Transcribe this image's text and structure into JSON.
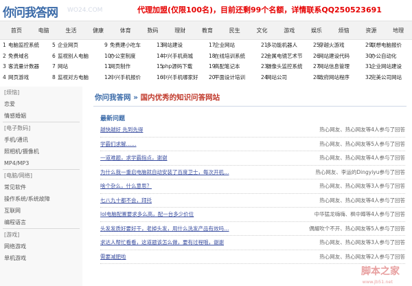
{
  "header": {
    "logo": "你问我答网",
    "logo_sub": "WO24.COM",
    "promo": "代理加盟(仅限100名)，目前还剩99个名额，详情联系QQ250523691"
  },
  "nav": [
    "首页",
    "电脑",
    "生活",
    "健康",
    "体育",
    "数码",
    "理财",
    "教育",
    "民生",
    "文化",
    "游戏",
    "娱乐",
    "烦恼",
    "资源",
    "地理"
  ],
  "links": [
    [
      [
        "1",
        "电脑监控系统"
      ],
      [
        "5",
        "企业网页"
      ],
      [
        "9",
        "免费建小吃车"
      ],
      [
        "13",
        "网站建设"
      ],
      [
        "17",
        "企业网站"
      ],
      [
        "21",
        "多功能机器人"
      ],
      [
        "25",
        "穿越火游戏"
      ],
      [
        "29",
        "联想电脑报价"
      ]
    ],
    [
      [
        "2",
        "免费域名"
      ],
      [
        "6",
        "监视别人电脑"
      ],
      [
        "10",
        "办公室制度"
      ],
      [
        "14",
        "中兴手机商城"
      ],
      [
        "18",
        "在线培训系统"
      ],
      [
        "22",
        "金属电镜艺术节"
      ],
      [
        "26",
        "网站建设代码"
      ],
      [
        "30",
        "办公自动化"
      ]
    ],
    [
      [
        "3",
        "客流量计数器"
      ],
      [
        "7",
        "网站"
      ],
      [
        "11",
        "网页制作"
      ],
      [
        "15",
        "php源码下载"
      ],
      [
        "19",
        "高配笔记本"
      ],
      [
        "23",
        "摄像头监控系统"
      ],
      [
        "27",
        "网站信息管理"
      ],
      [
        "31",
        "企业网站建设"
      ]
    ],
    [
      [
        "4",
        "网页游戏"
      ],
      [
        "8",
        "监视对方电脑"
      ],
      [
        "12",
        "中兴手机报价"
      ],
      [
        "16",
        "中兴手机哪家好"
      ],
      [
        "20",
        "平面设计培训"
      ],
      [
        "24",
        "网站公司"
      ],
      [
        "28",
        "政府网站程序"
      ],
      [
        "32",
        "完美公司网站"
      ]
    ]
  ],
  "sidebar": [
    {
      "label": "[烦恼]",
      "cat": true
    },
    {
      "label": "恋爱",
      "cat": false
    },
    {
      "label": "情感婚姻",
      "cat": false
    },
    {
      "sep": true
    },
    {
      "label": "[电子数码]",
      "cat": true
    },
    {
      "label": "手机/通讯",
      "cat": false
    },
    {
      "label": "照相机/摄像机",
      "cat": false
    },
    {
      "label": "MP4/MP3",
      "cat": false
    },
    {
      "sep": true
    },
    {
      "label": "[电脑/网络]",
      "cat": true
    },
    {
      "label": "常见软件",
      "cat": false
    },
    {
      "label": "操作系统/系统故障",
      "cat": false
    },
    {
      "label": "互联网",
      "cat": false
    },
    {
      "label": "编程语言",
      "cat": false
    },
    {
      "sep": true
    },
    {
      "label": "[游戏]",
      "cat": true
    },
    {
      "label": "网络游戏",
      "cat": false
    },
    {
      "label": "单机游戏",
      "cat": false
    }
  ],
  "breadcrumb": {
    "home": "你问我答网",
    "sep": " » ",
    "current": "国内优秀的知识问答网站"
  },
  "section_title": "最新问题",
  "questions": [
    {
      "title": "越快越好 先到先得",
      "meta": "热心网友、热心网友等4人参与了回答"
    },
    {
      "title": "学霸们求解……",
      "meta": "热心网友、热心网友等5人参与了回答"
    },
    {
      "title": "一道难题，求学霸指点，谢谢",
      "meta": "热心网友、热心网友等4人参与了回答"
    },
    {
      "title": "为什么我一重启电脑就自动安装了百度卫士，每次开机…",
      "meta": "热心网友、李运的Dingyiyu参与了回答"
    },
    {
      "title": "啥个杂么，什么意思？",
      "meta": "热心网友、热心网友等3人参与了回答"
    },
    {
      "title": "七八九十都不会，拜托",
      "meta": "热心网友、热心网友等4人参与了回答"
    },
    {
      "title": "lol电脑配置要求多么高，配一台多少价位",
      "meta": "中华猛龙嗨嗨、枫中蹲等4人参与了回答"
    },
    {
      "title": "头发发质好要好干，老掉头发，用什么洗发产品有效吗…",
      "meta": "偶耀吹个不开、热心网友等5人参与了回答"
    },
    {
      "title": "求达人帮忙看看，这道题该怎么做，要有过程哦，谢谢",
      "meta": "热心网友、热心网友等3人参与了回答"
    },
    {
      "title": "需要减肥啦",
      "meta": "热心网友、热心网友等2人参与了回答"
    }
  ],
  "watermark": "脚本之家",
  "watermark_url": "www.jb51.net"
}
